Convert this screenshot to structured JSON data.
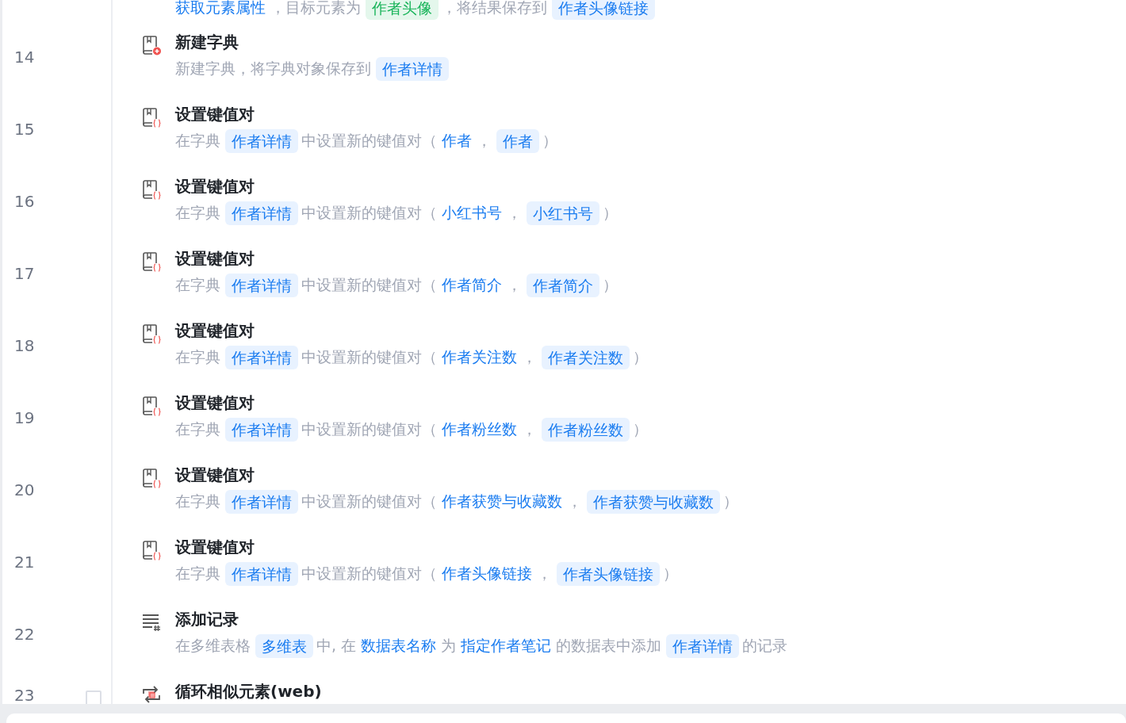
{
  "steps": [
    {
      "parts": [
        {
          "kind": "value",
          "text": "获取元素属性"
        },
        {
          "kind": "text",
          "text": "，目标元素为"
        },
        {
          "kind": "green",
          "text": "作者头像"
        },
        {
          "kind": "text",
          "text": "，将结果保存到"
        },
        {
          "kind": "tag",
          "text": "作者头像链接"
        }
      ]
    },
    {
      "number": "14",
      "kind": "new-dict",
      "title": "新建字典",
      "parts": [
        {
          "kind": "text",
          "text": "新建字典，将字典对象保存到"
        },
        {
          "kind": "tag",
          "text": "作者详情"
        }
      ]
    },
    {
      "number": "15",
      "kind": "set-kv",
      "title": "设置键值对",
      "parts": [
        {
          "kind": "text",
          "text": "在字典"
        },
        {
          "kind": "tag",
          "text": "作者详情"
        },
        {
          "kind": "text",
          "text": "中设置新的键值对（"
        },
        {
          "kind": "value",
          "text": "作者"
        },
        {
          "kind": "text",
          "text": "，"
        },
        {
          "kind": "tag",
          "text": "作者"
        },
        {
          "kind": "text",
          "text": "）"
        }
      ]
    },
    {
      "number": "16",
      "kind": "set-kv",
      "title": "设置键值对",
      "parts": [
        {
          "kind": "text",
          "text": "在字典"
        },
        {
          "kind": "tag",
          "text": "作者详情"
        },
        {
          "kind": "text",
          "text": "中设置新的键值对（"
        },
        {
          "kind": "value",
          "text": "小红书号"
        },
        {
          "kind": "text",
          "text": "，"
        },
        {
          "kind": "tag",
          "text": "小红书号"
        },
        {
          "kind": "text",
          "text": "）"
        }
      ]
    },
    {
      "number": "17",
      "kind": "set-kv",
      "title": "设置键值对",
      "parts": [
        {
          "kind": "text",
          "text": "在字典"
        },
        {
          "kind": "tag",
          "text": "作者详情"
        },
        {
          "kind": "text",
          "text": "中设置新的键值对（"
        },
        {
          "kind": "value",
          "text": "作者简介"
        },
        {
          "kind": "text",
          "text": "，"
        },
        {
          "kind": "tag",
          "text": "作者简介"
        },
        {
          "kind": "text",
          "text": "）"
        }
      ]
    },
    {
      "number": "18",
      "kind": "set-kv",
      "title": "设置键值对",
      "parts": [
        {
          "kind": "text",
          "text": "在字典"
        },
        {
          "kind": "tag",
          "text": "作者详情"
        },
        {
          "kind": "text",
          "text": "中设置新的键值对（"
        },
        {
          "kind": "value",
          "text": "作者关注数"
        },
        {
          "kind": "text",
          "text": "，"
        },
        {
          "kind": "tag",
          "text": "作者关注数"
        },
        {
          "kind": "text",
          "text": "）"
        }
      ]
    },
    {
      "number": "19",
      "kind": "set-kv",
      "title": "设置键值对",
      "parts": [
        {
          "kind": "text",
          "text": "在字典"
        },
        {
          "kind": "tag",
          "text": "作者详情"
        },
        {
          "kind": "text",
          "text": "中设置新的键值对（"
        },
        {
          "kind": "value",
          "text": "作者粉丝数"
        },
        {
          "kind": "text",
          "text": "，"
        },
        {
          "kind": "tag",
          "text": "作者粉丝数"
        },
        {
          "kind": "text",
          "text": "）"
        }
      ]
    },
    {
      "number": "20",
      "kind": "set-kv",
      "title": "设置键值对",
      "parts": [
        {
          "kind": "text",
          "text": "在字典"
        },
        {
          "kind": "tag",
          "text": "作者详情"
        },
        {
          "kind": "text",
          "text": "中设置新的键值对（"
        },
        {
          "kind": "value",
          "text": "作者获赞与收藏数"
        },
        {
          "kind": "text",
          "text": "，"
        },
        {
          "kind": "tag",
          "text": "作者获赞与收藏数"
        },
        {
          "kind": "text",
          "text": "）"
        }
      ]
    },
    {
      "number": "21",
      "kind": "set-kv",
      "title": "设置键值对",
      "parts": [
        {
          "kind": "text",
          "text": "在字典"
        },
        {
          "kind": "tag",
          "text": "作者详情"
        },
        {
          "kind": "text",
          "text": "中设置新的键值对（"
        },
        {
          "kind": "value",
          "text": "作者头像链接"
        },
        {
          "kind": "text",
          "text": "，"
        },
        {
          "kind": "tag",
          "text": "作者头像链接"
        },
        {
          "kind": "text",
          "text": "）"
        }
      ]
    },
    {
      "number": "22",
      "kind": "add-record",
      "title": "添加记录",
      "parts": [
        {
          "kind": "text",
          "text": "在多维表格"
        },
        {
          "kind": "tag",
          "text": "多维表"
        },
        {
          "kind": "text",
          "text": "中, 在"
        },
        {
          "kind": "value",
          "text": "数据表名称"
        },
        {
          "kind": "text",
          "text": "为"
        },
        {
          "kind": "value",
          "text": "指定作者笔记"
        },
        {
          "kind": "text",
          "text": "的数据表中添加"
        },
        {
          "kind": "tag",
          "text": "作者详情"
        },
        {
          "kind": "text",
          "text": "的记录"
        }
      ]
    },
    {
      "number": "23",
      "kind": "loop",
      "title": "循环相似元素(web)",
      "checkbox": {
        "checked": false
      }
    }
  ]
}
